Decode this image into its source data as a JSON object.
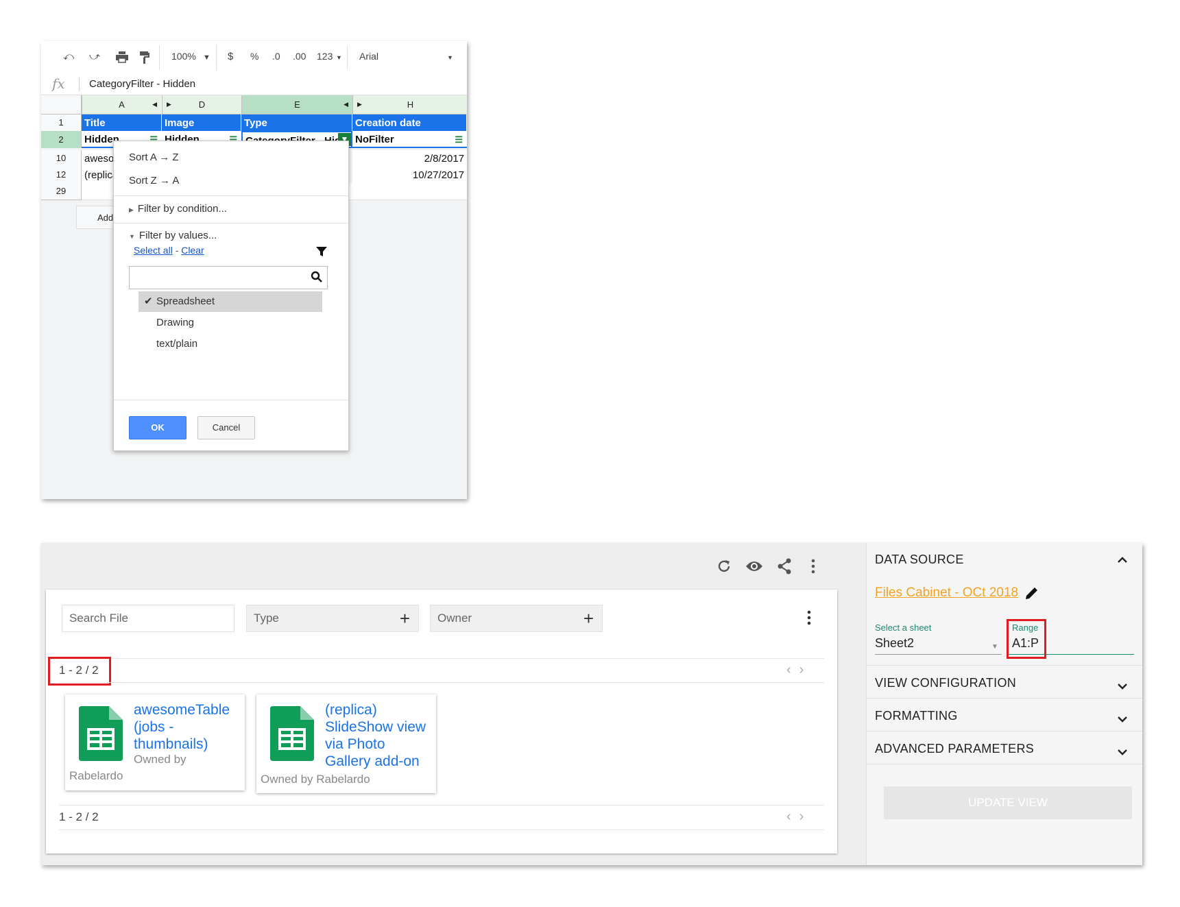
{
  "sheet": {
    "toolbar": {
      "zoom": "100%",
      "currency": "$",
      "percent": "%",
      "dec_less": ".0",
      "dec_more": ".00",
      "format_more": "123",
      "font": "Arial"
    },
    "formula": {
      "fx": "fx",
      "value": "CategoryFilter - Hidden"
    },
    "columns": [
      "A",
      "D",
      "E",
      "H"
    ],
    "rows": [
      "1",
      "2",
      "10",
      "12",
      "29"
    ],
    "header_row": [
      "Title",
      "Image",
      "Type",
      "Creation date"
    ],
    "filter_row": [
      "Hidden",
      "Hidden",
      "CategoryFilter - Hid",
      "NoFilter"
    ],
    "data_rows": [
      {
        "title": "awesor",
        "date": "2/8/2017"
      },
      {
        "title": "(replica",
        "date": "10/27/2017"
      }
    ],
    "add_label": "Add"
  },
  "filter_menu": {
    "sort_az": "Sort A → Z",
    "sort_za": "Sort Z → A",
    "by_condition": "Filter by condition...",
    "by_values": "Filter by values...",
    "select_all": "Select all",
    "separator": " - ",
    "clear": "Clear",
    "options": [
      {
        "label": "Spreadsheet",
        "checked": true
      },
      {
        "label": "Drawing",
        "checked": false
      },
      {
        "label": "text/plain",
        "checked": false
      }
    ],
    "ok": "OK",
    "cancel": "Cancel"
  },
  "app": {
    "search_placeholder": "Search File",
    "type_label": "Type",
    "owner_label": "Owner",
    "pager_top": "1 - 2 / 2",
    "pager_bottom": "1 - 2 / 2",
    "cards": [
      {
        "title_lines": [
          "awesomeTable",
          "(jobs -",
          "thumbnails)"
        ],
        "owned_by": "Owned by",
        "owner": "Rabelardo"
      },
      {
        "title_lines": [
          "(replica)",
          "SlideShow view",
          "via Photo",
          "Gallery add-on"
        ],
        "owned_by": "Owned by Rabelardo"
      }
    ],
    "icons": [
      "refresh-icon",
      "eye-icon",
      "share-icon",
      "more-vert-icon"
    ]
  },
  "side_panel": {
    "data_source": "DATA SOURCE",
    "source_link": "Files Cabinet - OCt 2018",
    "select_sheet_label": "Select a sheet",
    "sheet_value": "Sheet2",
    "range_label": "Range",
    "range_value": "A1:P",
    "view_configuration": "VIEW CONFIGURATION",
    "formatting": "FORMATTING",
    "advanced_parameters": "ADVANCED PARAMETERS",
    "update_button": "UPDATE VIEW"
  },
  "colors": {
    "sheet_blue": "#1a73e8",
    "awesome_orange": "#f4a221",
    "highlight_red": "#e01b24",
    "sheets_green": "#0f9d58"
  }
}
